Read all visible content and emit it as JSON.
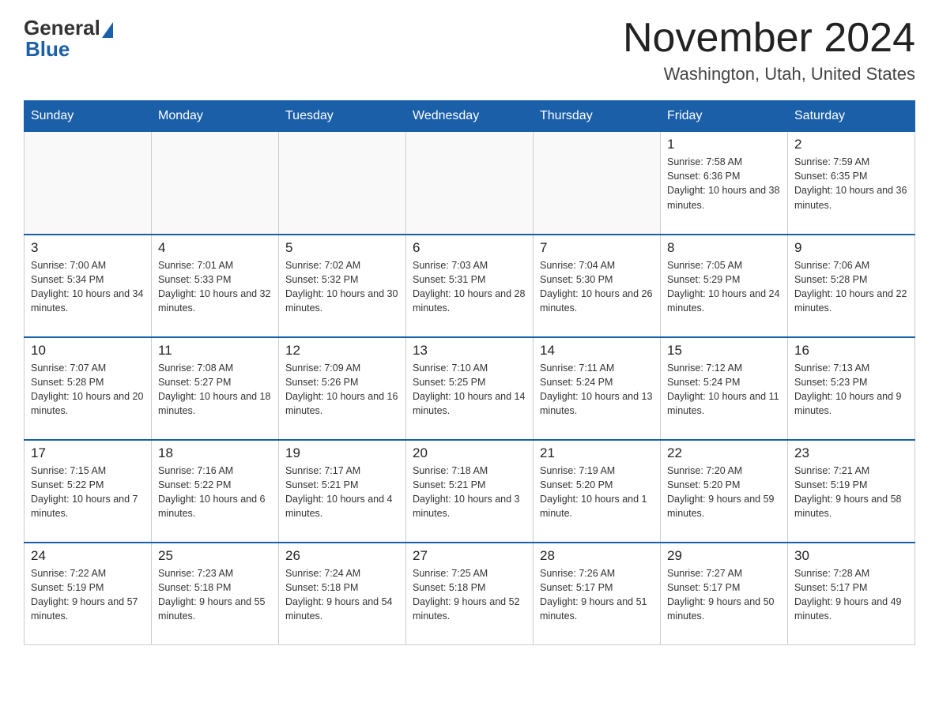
{
  "header": {
    "logo_general": "General",
    "logo_blue": "Blue",
    "month_title": "November 2024",
    "location": "Washington, Utah, United States"
  },
  "days_of_week": [
    "Sunday",
    "Monday",
    "Tuesday",
    "Wednesday",
    "Thursday",
    "Friday",
    "Saturday"
  ],
  "weeks": [
    [
      {
        "day": "",
        "info": ""
      },
      {
        "day": "",
        "info": ""
      },
      {
        "day": "",
        "info": ""
      },
      {
        "day": "",
        "info": ""
      },
      {
        "day": "",
        "info": ""
      },
      {
        "day": "1",
        "info": "Sunrise: 7:58 AM\nSunset: 6:36 PM\nDaylight: 10 hours and 38 minutes."
      },
      {
        "day": "2",
        "info": "Sunrise: 7:59 AM\nSunset: 6:35 PM\nDaylight: 10 hours and 36 minutes."
      }
    ],
    [
      {
        "day": "3",
        "info": "Sunrise: 7:00 AM\nSunset: 5:34 PM\nDaylight: 10 hours and 34 minutes."
      },
      {
        "day": "4",
        "info": "Sunrise: 7:01 AM\nSunset: 5:33 PM\nDaylight: 10 hours and 32 minutes."
      },
      {
        "day": "5",
        "info": "Sunrise: 7:02 AM\nSunset: 5:32 PM\nDaylight: 10 hours and 30 minutes."
      },
      {
        "day": "6",
        "info": "Sunrise: 7:03 AM\nSunset: 5:31 PM\nDaylight: 10 hours and 28 minutes."
      },
      {
        "day": "7",
        "info": "Sunrise: 7:04 AM\nSunset: 5:30 PM\nDaylight: 10 hours and 26 minutes."
      },
      {
        "day": "8",
        "info": "Sunrise: 7:05 AM\nSunset: 5:29 PM\nDaylight: 10 hours and 24 minutes."
      },
      {
        "day": "9",
        "info": "Sunrise: 7:06 AM\nSunset: 5:28 PM\nDaylight: 10 hours and 22 minutes."
      }
    ],
    [
      {
        "day": "10",
        "info": "Sunrise: 7:07 AM\nSunset: 5:28 PM\nDaylight: 10 hours and 20 minutes."
      },
      {
        "day": "11",
        "info": "Sunrise: 7:08 AM\nSunset: 5:27 PM\nDaylight: 10 hours and 18 minutes."
      },
      {
        "day": "12",
        "info": "Sunrise: 7:09 AM\nSunset: 5:26 PM\nDaylight: 10 hours and 16 minutes."
      },
      {
        "day": "13",
        "info": "Sunrise: 7:10 AM\nSunset: 5:25 PM\nDaylight: 10 hours and 14 minutes."
      },
      {
        "day": "14",
        "info": "Sunrise: 7:11 AM\nSunset: 5:24 PM\nDaylight: 10 hours and 13 minutes."
      },
      {
        "day": "15",
        "info": "Sunrise: 7:12 AM\nSunset: 5:24 PM\nDaylight: 10 hours and 11 minutes."
      },
      {
        "day": "16",
        "info": "Sunrise: 7:13 AM\nSunset: 5:23 PM\nDaylight: 10 hours and 9 minutes."
      }
    ],
    [
      {
        "day": "17",
        "info": "Sunrise: 7:15 AM\nSunset: 5:22 PM\nDaylight: 10 hours and 7 minutes."
      },
      {
        "day": "18",
        "info": "Sunrise: 7:16 AM\nSunset: 5:22 PM\nDaylight: 10 hours and 6 minutes."
      },
      {
        "day": "19",
        "info": "Sunrise: 7:17 AM\nSunset: 5:21 PM\nDaylight: 10 hours and 4 minutes."
      },
      {
        "day": "20",
        "info": "Sunrise: 7:18 AM\nSunset: 5:21 PM\nDaylight: 10 hours and 3 minutes."
      },
      {
        "day": "21",
        "info": "Sunrise: 7:19 AM\nSunset: 5:20 PM\nDaylight: 10 hours and 1 minute."
      },
      {
        "day": "22",
        "info": "Sunrise: 7:20 AM\nSunset: 5:20 PM\nDaylight: 9 hours and 59 minutes."
      },
      {
        "day": "23",
        "info": "Sunrise: 7:21 AM\nSunset: 5:19 PM\nDaylight: 9 hours and 58 minutes."
      }
    ],
    [
      {
        "day": "24",
        "info": "Sunrise: 7:22 AM\nSunset: 5:19 PM\nDaylight: 9 hours and 57 minutes."
      },
      {
        "day": "25",
        "info": "Sunrise: 7:23 AM\nSunset: 5:18 PM\nDaylight: 9 hours and 55 minutes."
      },
      {
        "day": "26",
        "info": "Sunrise: 7:24 AM\nSunset: 5:18 PM\nDaylight: 9 hours and 54 minutes."
      },
      {
        "day": "27",
        "info": "Sunrise: 7:25 AM\nSunset: 5:18 PM\nDaylight: 9 hours and 52 minutes."
      },
      {
        "day": "28",
        "info": "Sunrise: 7:26 AM\nSunset: 5:17 PM\nDaylight: 9 hours and 51 minutes."
      },
      {
        "day": "29",
        "info": "Sunrise: 7:27 AM\nSunset: 5:17 PM\nDaylight: 9 hours and 50 minutes."
      },
      {
        "day": "30",
        "info": "Sunrise: 7:28 AM\nSunset: 5:17 PM\nDaylight: 9 hours and 49 minutes."
      }
    ]
  ]
}
